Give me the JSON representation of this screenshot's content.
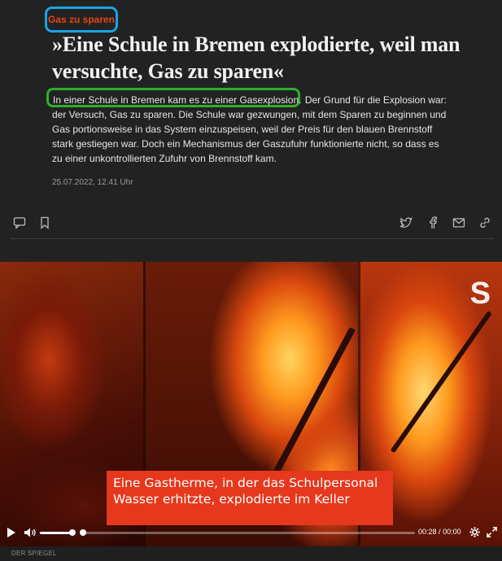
{
  "article": {
    "kicker": "Gas zu sparen",
    "headline": "»Eine Schule in Bremen explodierte, weil man versuchte, Gas zu sparen«",
    "lead_highlight": "In einer Schule in Bremen kam es zu einer Gasexplosion.",
    "lead_rest": " Der Grund für die Explosion war: der Versuch, Gas zu sparen. Die Schule war gezwungen, mit dem Sparen zu beginnen und Gas portionsweise in das System einzuspeisen, weil der Preis für den blauen Brennstoff stark gestiegen war. Doch ein Mechanismus der Gaszufuhr funktionierte nicht, so dass es zu einer unkontrollierten Zufuhr von Brennstoff kam.",
    "date": "25.07.2022, 12.41 Uhr"
  },
  "toolbar": {
    "icons": [
      "comment-icon",
      "bookmark-icon",
      "twitter-icon",
      "facebook-icon",
      "mail-icon",
      "link-icon"
    ]
  },
  "video": {
    "logo": "S",
    "subtitle_line1": "Eine Gastherme, in der das Schulpersonal",
    "subtitle_line2": "Wasser erhitzte, explodierte im Keller",
    "current_time": "00:28",
    "separator": "/",
    "duration": "00:00",
    "volume_fraction": 0.9,
    "progress_fraction": 0.0,
    "credit": "DER SPIEGEL"
  },
  "colors": {
    "kicker": "#e64415",
    "kicker_box": "#1aa3e8",
    "highlight_box": "#2fae2a",
    "subtitle_bg": "#e5381c"
  }
}
